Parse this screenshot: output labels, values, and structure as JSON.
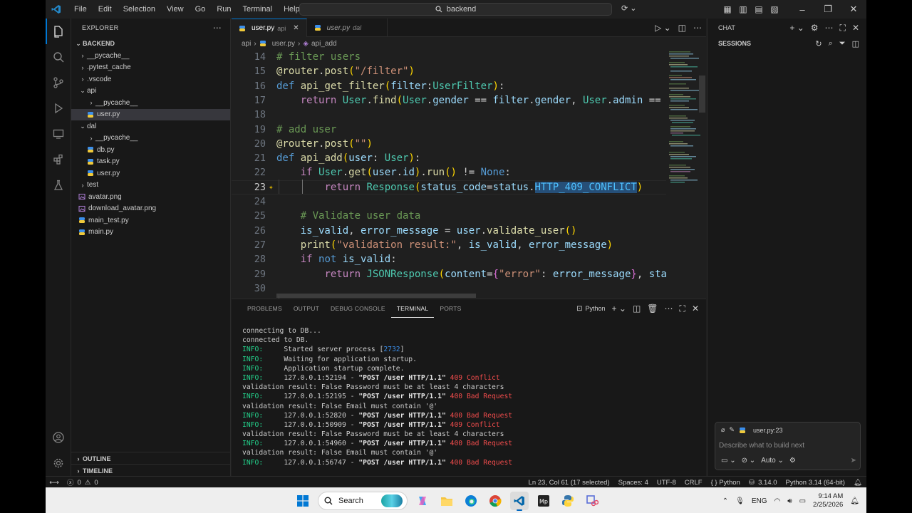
{
  "window": {
    "menu": [
      "File",
      "Edit",
      "Selection",
      "View",
      "Go",
      "Run",
      "Terminal",
      "Help"
    ],
    "search_text": "backend"
  },
  "explorer": {
    "title": "EXPLORER",
    "root": "BACKEND",
    "tree": [
      {
        "label": "__pycache__",
        "kind": "folder",
        "open": false,
        "depth": 1
      },
      {
        "label": ".pytest_cache",
        "kind": "folder",
        "open": false,
        "depth": 1
      },
      {
        "label": ".vscode",
        "kind": "folder",
        "open": false,
        "depth": 1
      },
      {
        "label": "api",
        "kind": "folder",
        "open": true,
        "depth": 1
      },
      {
        "label": "__pycache__",
        "kind": "folder",
        "open": false,
        "depth": 2
      },
      {
        "label": "user.py",
        "kind": "py",
        "depth": 2,
        "selected": true
      },
      {
        "label": "dal",
        "kind": "folder",
        "open": true,
        "depth": 1
      },
      {
        "label": "__pycache__",
        "kind": "folder",
        "open": false,
        "depth": 2
      },
      {
        "label": "db.py",
        "kind": "py",
        "depth": 2
      },
      {
        "label": "task.py",
        "kind": "py",
        "depth": 2
      },
      {
        "label": "user.py",
        "kind": "py",
        "depth": 2
      },
      {
        "label": "test",
        "kind": "folder",
        "open": false,
        "depth": 1
      },
      {
        "label": "avatar.png",
        "kind": "png",
        "depth": 1
      },
      {
        "label": "download_avatar.png",
        "kind": "png",
        "depth": 1
      },
      {
        "label": "main_test.py",
        "kind": "py",
        "depth": 1
      },
      {
        "label": "main.py",
        "kind": "py",
        "depth": 1
      }
    ],
    "outline": "OUTLINE",
    "timeline": "TIMELINE"
  },
  "editor": {
    "tabs": [
      {
        "label": "user.py",
        "desc": "api",
        "active": true
      },
      {
        "label": "user.py",
        "desc": "dal",
        "active": false
      }
    ],
    "breadcrumb": [
      "api",
      "user.py",
      "api_add"
    ],
    "lines": [
      {
        "n": "14"
      },
      {
        "n": "15"
      },
      {
        "n": "16"
      },
      {
        "n": "17"
      },
      {
        "n": "18"
      },
      {
        "n": "19"
      },
      {
        "n": "20"
      },
      {
        "n": "21"
      },
      {
        "n": "22"
      },
      {
        "n": "23"
      },
      {
        "n": "24"
      },
      {
        "n": "25"
      },
      {
        "n": "26"
      },
      {
        "n": "27"
      },
      {
        "n": "28"
      },
      {
        "n": "29"
      },
      {
        "n": "30"
      }
    ]
  },
  "panel": {
    "tabs": [
      "PROBLEMS",
      "OUTPUT",
      "DEBUG CONSOLE",
      "TERMINAL",
      "PORTS"
    ],
    "active_tab": "TERMINAL",
    "shell": "Python",
    "terminal": [
      {
        "plain": "connecting to DB..."
      },
      {
        "plain": "connected to DB."
      },
      {
        "info": "INFO:",
        "text": "     Started server process [",
        "num": "2732",
        "tail": "]"
      },
      {
        "info": "INFO:",
        "text": "     Waiting for application startup."
      },
      {
        "info": "INFO:",
        "text": "     Application startup complete."
      },
      {
        "info": "INFO:",
        "text": "     127.0.0.1:52194 - ",
        "req": "\"POST /user HTTP/1.1\"",
        "status": " 409 Conflict"
      },
      {
        "plain": "validation result: False Password must be at least 4 characters"
      },
      {
        "info": "INFO:",
        "text": "     127.0.0.1:52195 - ",
        "req": "\"POST /user HTTP/1.1\"",
        "status": " 400 Bad Request"
      },
      {
        "plain": "validation result: False Email must contain '@'"
      },
      {
        "info": "INFO:",
        "text": "     127.0.0.1:52820 - ",
        "req": "\"POST /user HTTP/1.1\"",
        "status": " 400 Bad Request"
      },
      {
        "info": "INFO:",
        "text": "     127.0.0.1:50909 - ",
        "req": "\"POST /user HTTP/1.1\"",
        "status": " 409 Conflict"
      },
      {
        "plain": "validation result: False Password must be at least 4 characters"
      },
      {
        "info": "INFO:",
        "text": "     127.0.0.1:54960 - ",
        "req": "\"POST /user HTTP/1.1\"",
        "status": " 400 Bad Request"
      },
      {
        "plain": "validation result: False Email must contain '@'"
      },
      {
        "info": "INFO:",
        "text": "     127.0.0.1:56747 - ",
        "req": "\"POST /user HTTP/1.1\"",
        "status": " 400 Bad Request"
      }
    ]
  },
  "chat": {
    "title": "CHAT",
    "sessions": "SESSIONS",
    "context_file": "user.py:23",
    "placeholder": "Describe what to build next",
    "mode": "Auto"
  },
  "statusbar": {
    "errors": "0",
    "warnings": "0",
    "position": "Ln 23, Col 61 (17 selected)",
    "spaces": "Spaces: 4",
    "encoding": "UTF-8",
    "eol": "CRLF",
    "language": "Python",
    "version": "3.14.0",
    "interpreter": "Python 3.14 (64-bit)"
  },
  "taskbar": {
    "search": "Search",
    "lang": "ENG",
    "time": "9:14 AM",
    "date": "2/25/2026"
  }
}
